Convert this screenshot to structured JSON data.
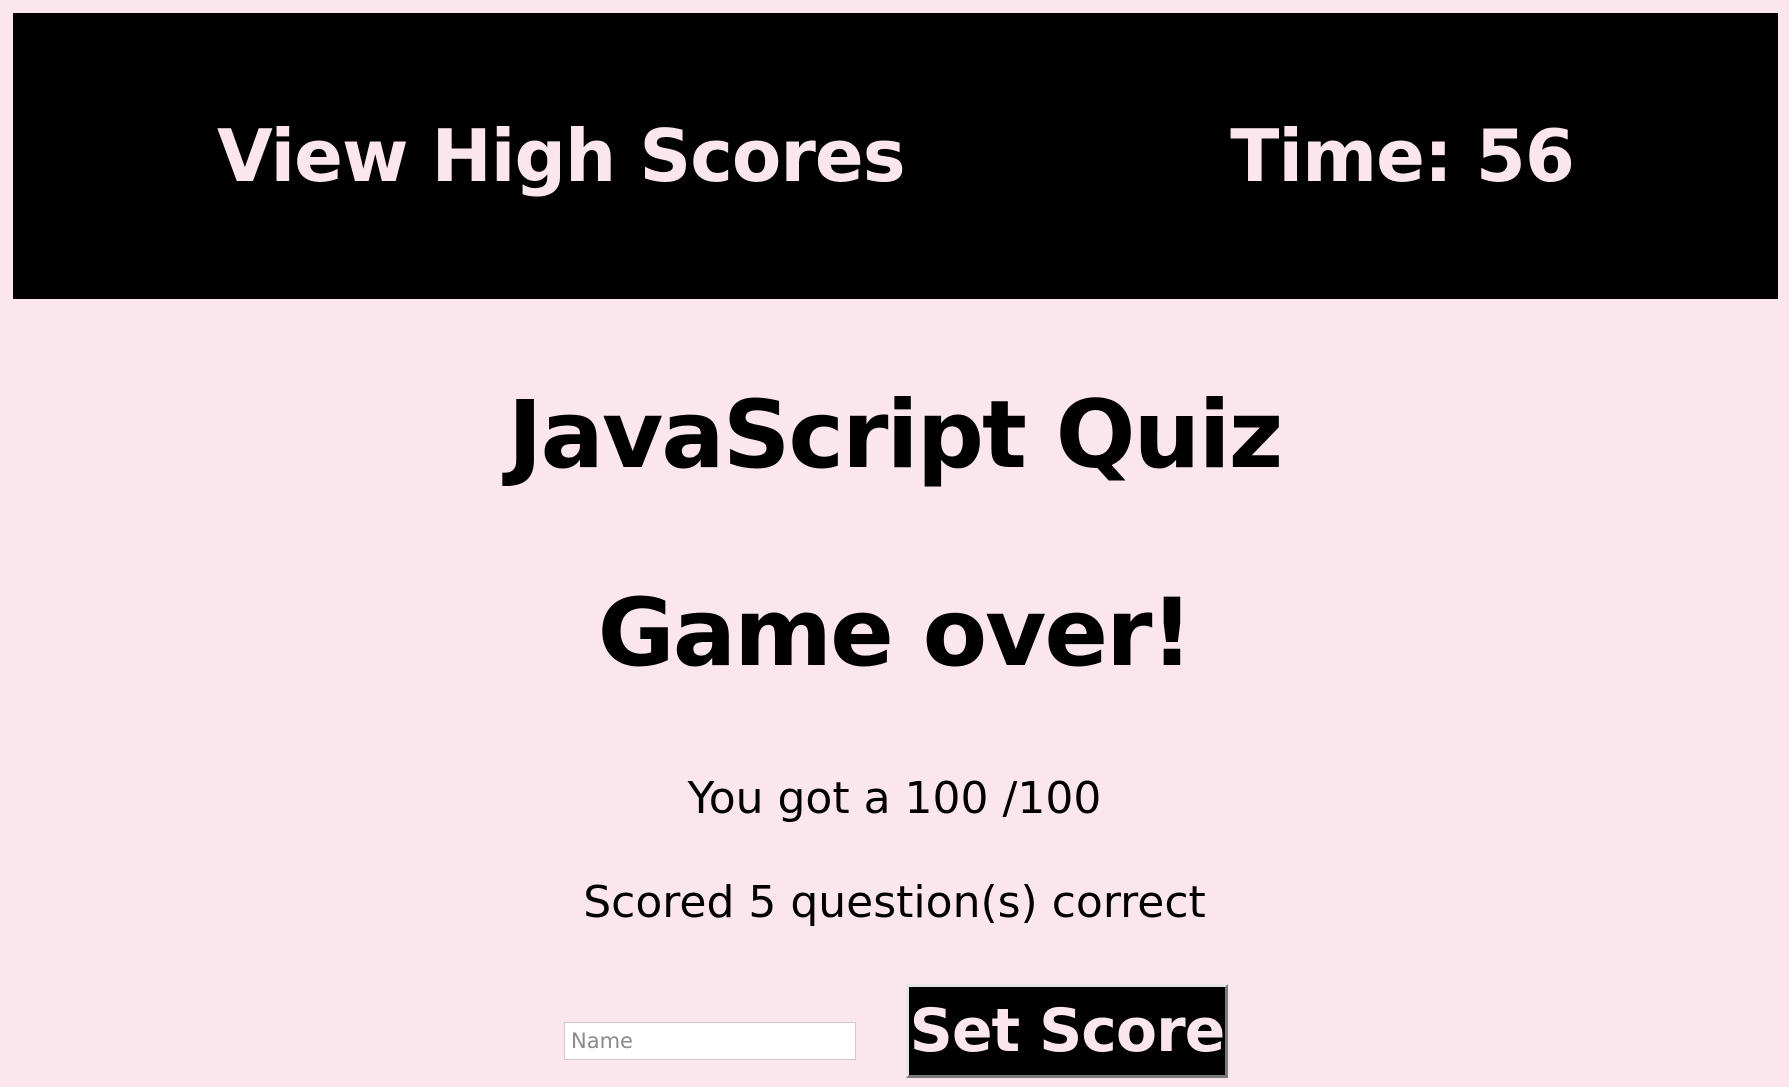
{
  "header": {
    "high_scores_label": "View High Scores",
    "timer_text": "Time: 56"
  },
  "main": {
    "title": "JavaScript Quiz",
    "status": "Game over!",
    "score_text": "You got a 100 /100",
    "correct_text": "Scored 5 question(s) correct"
  },
  "form": {
    "name_placeholder": "Name",
    "name_value": "",
    "submit_label": "Set Score"
  },
  "colors": {
    "background": "#fae6ec",
    "header_bg": "#000000",
    "header_text": "#fae6ec",
    "button_bg": "#000000"
  }
}
